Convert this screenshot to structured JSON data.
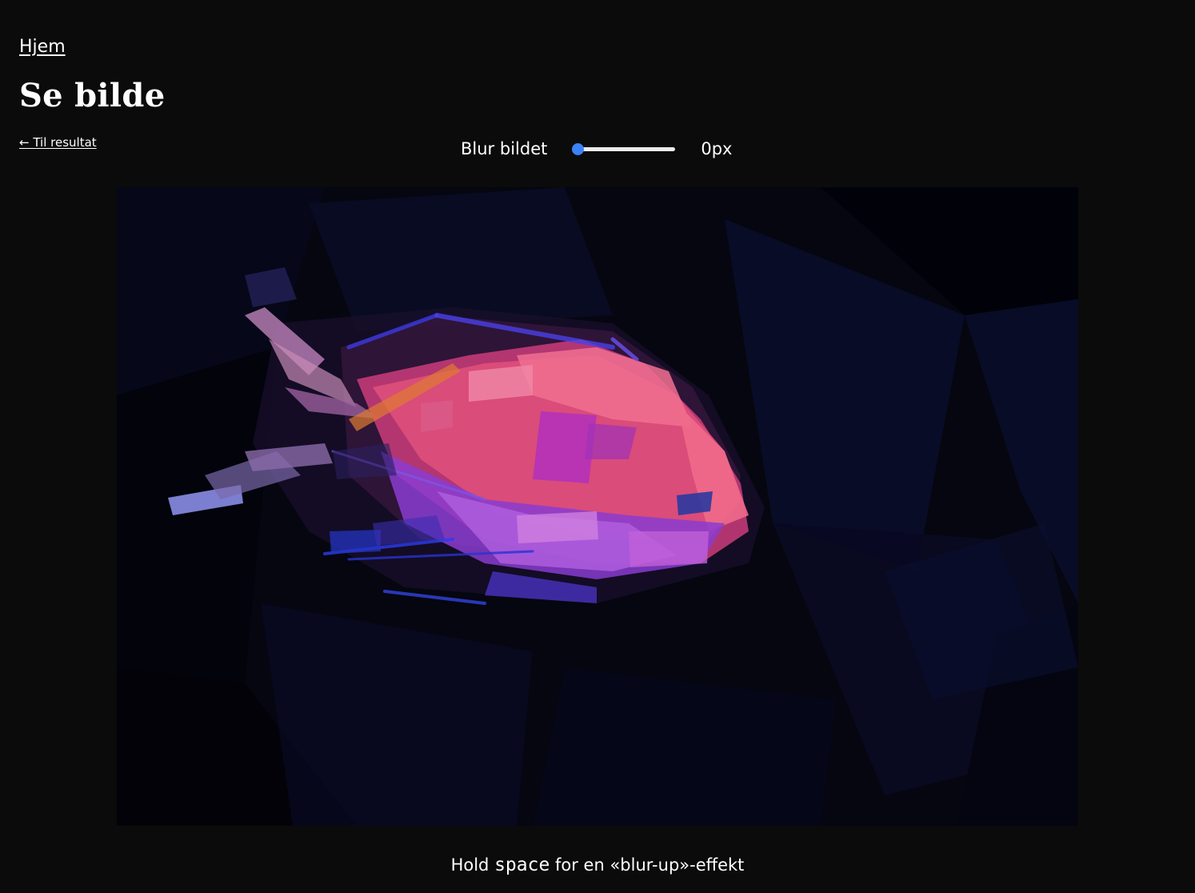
{
  "nav": {
    "home_label": "Hjem"
  },
  "page": {
    "title": "Se bilde",
    "back_label": "← Til resultat"
  },
  "blur": {
    "label": "Blur bildet",
    "value": 0,
    "min": 0,
    "max": 30,
    "value_text": "0px"
  },
  "hint": {
    "prefix": "Hold ",
    "key": "space",
    "suffix": " for en «blur-up»-effekt"
  },
  "image": {
    "icon": "fish-artwork",
    "background": "#05060f"
  },
  "colors": {
    "page_background": "#0b0b0b",
    "accent": "#3b82f6",
    "text": "#ffffff"
  }
}
